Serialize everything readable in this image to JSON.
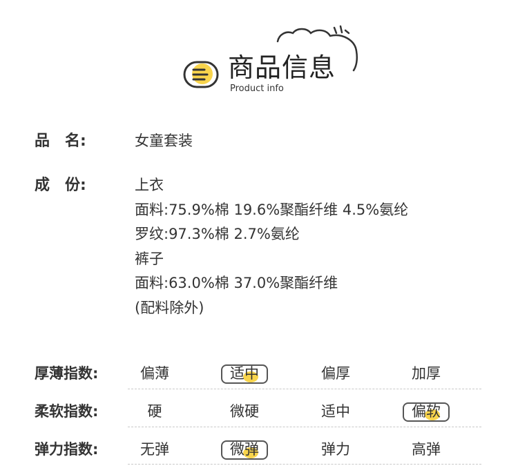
{
  "header": {
    "title_cn": "商品信息",
    "title_en": "Product info",
    "accent_color": "#f8d44c"
  },
  "product": {
    "name_label": "品　名:",
    "name_value": "女童套装",
    "composition_label": "成　份:",
    "composition_lines": [
      "上衣",
      "面料:75.9%棉 19.6%聚酯纤维 4.5%氨纶",
      "罗纹:97.3%棉 2.7%氨纶",
      "裤子",
      "面料:63.0%棉 37.0%聚酯纤维",
      "(配料除外)"
    ]
  },
  "scales": [
    {
      "label": "厚薄指数:",
      "options": [
        "偏薄",
        "适中",
        "偏厚",
        "加厚"
      ],
      "selected_index": 1
    },
    {
      "label": "柔软指数:",
      "options": [
        "硬",
        "微硬",
        "适中",
        "偏软"
      ],
      "selected_index": 3
    },
    {
      "label": "弹力指数:",
      "options": [
        "无弹",
        "微弹",
        "弹力",
        "高弹"
      ],
      "selected_index": 1
    }
  ]
}
